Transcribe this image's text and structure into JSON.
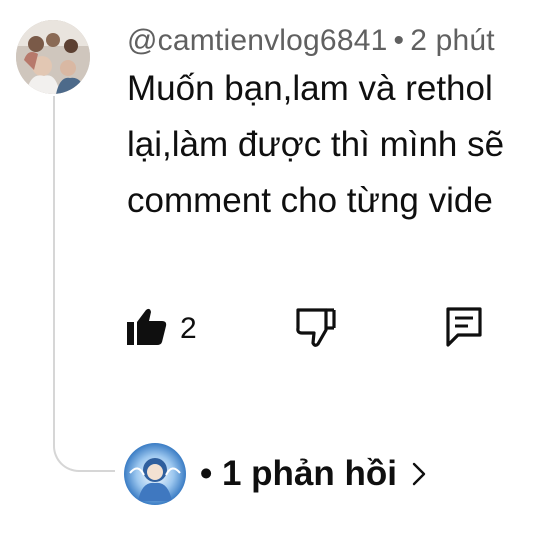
{
  "comment": {
    "author_handle": "@camtienvlog6841",
    "separator": "•",
    "timestamp": "2 phút",
    "text_lines": [
      "Muốn bạn,lam và rethol",
      "lại,làm được thì mình sẽ",
      "comment cho từng vide"
    ],
    "like_count": "2",
    "icons": {
      "like": "thumbs-up-filled-icon",
      "dislike": "thumbs-down-outline-icon",
      "reply": "comment-reply-icon"
    }
  },
  "replies": {
    "label": "• 1 phản hồi",
    "chevron": "chevron-right-icon"
  },
  "colors": {
    "text_primary": "#0f0f0f",
    "text_secondary": "#606060",
    "thread_line": "#d6d6d6",
    "reply_avatar_bg": "#6fa8dc"
  }
}
